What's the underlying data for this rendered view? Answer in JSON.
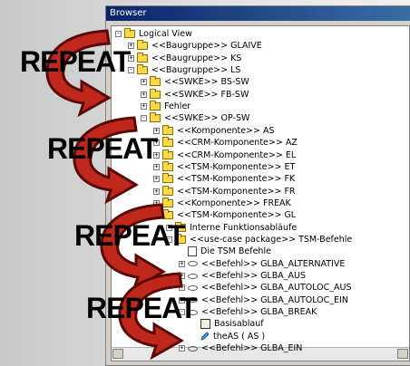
{
  "window": {
    "title": "Browser"
  },
  "tree": {
    "rows": [
      {
        "label": "Logical View",
        "expander": "-",
        "icon": "folder"
      },
      {
        "label": "<<Baugruppe>> GLAIVE",
        "expander": "+",
        "icon": "folder"
      },
      {
        "label": "<<Baugruppe>> KS",
        "expander": "+",
        "icon": "folder"
      },
      {
        "label": "<<Baugruppe>> LS",
        "expander": "-",
        "icon": "folder"
      },
      {
        "label": "<<SWKE>> BS-SW",
        "expander": "+",
        "icon": "folder"
      },
      {
        "label": "<<SWKE>> FB-SW",
        "expander": "+",
        "icon": "folder"
      },
      {
        "label": "Fehler",
        "expander": "+",
        "icon": "folder"
      },
      {
        "label": "<<SWKE>> OP-SW",
        "expander": "-",
        "icon": "folder"
      },
      {
        "label": "<<Komponente>> AS",
        "expander": "+",
        "icon": "folder"
      },
      {
        "label": "<<CRM-Komponente>> AZ",
        "expander": "+",
        "icon": "folder"
      },
      {
        "label": "<<CRM-Komponente>> EL",
        "expander": "+",
        "icon": "folder"
      },
      {
        "label": "<<TSM-Komponente>> ET",
        "expander": "+",
        "icon": "folder"
      },
      {
        "label": "<<TSM-Komponente>> FK",
        "expander": "+",
        "icon": "folder"
      },
      {
        "label": "<<TSM-Komponente>> FR",
        "expander": "+",
        "icon": "folder"
      },
      {
        "label": "<<Komponente>> FREAK",
        "expander": "+",
        "icon": "folder"
      },
      {
        "label": "<<TSM-Komponente>> GL",
        "expander": "-",
        "icon": "folder"
      },
      {
        "label": "Interne Funktionsabläufe",
        "expander": "-",
        "icon": "folder"
      },
      {
        "label": "<<use-case package>> TSM-Befehle",
        "expander": "-",
        "icon": "folder"
      },
      {
        "label": "Die TSM Befehle",
        "expander": "",
        "icon": "doc"
      },
      {
        "label": "<<Befehl>> GLBA_ALTERNATIVE",
        "expander": "+",
        "icon": "eye"
      },
      {
        "label": "<<Befehl>> GLBA_AUS",
        "expander": "+",
        "icon": "eye"
      },
      {
        "label": "<<Befehl>> GLBA_AUTOLOC_AUS",
        "expander": "+",
        "icon": "eye"
      },
      {
        "label": "<<Befehl>> GLBA_AUTOLOC_EIN",
        "expander": "+",
        "icon": "eye"
      },
      {
        "label": "<<Befehl>> GLBA_BREAK",
        "expander": "-",
        "icon": "eye"
      },
      {
        "label": "Basisablauf",
        "expander": "",
        "icon": "diagram"
      },
      {
        "label": "theAS ( AS )",
        "expander": "",
        "icon": "pencil"
      },
      {
        "label": "<<Befehl>> GLBA_EIN",
        "expander": "+",
        "icon": "eye"
      }
    ]
  },
  "overlay": {
    "watermark_text": "REPEAT",
    "count": 4,
    "arrow_color": "#c0281e",
    "arrow_outline": "#5a0a06"
  }
}
